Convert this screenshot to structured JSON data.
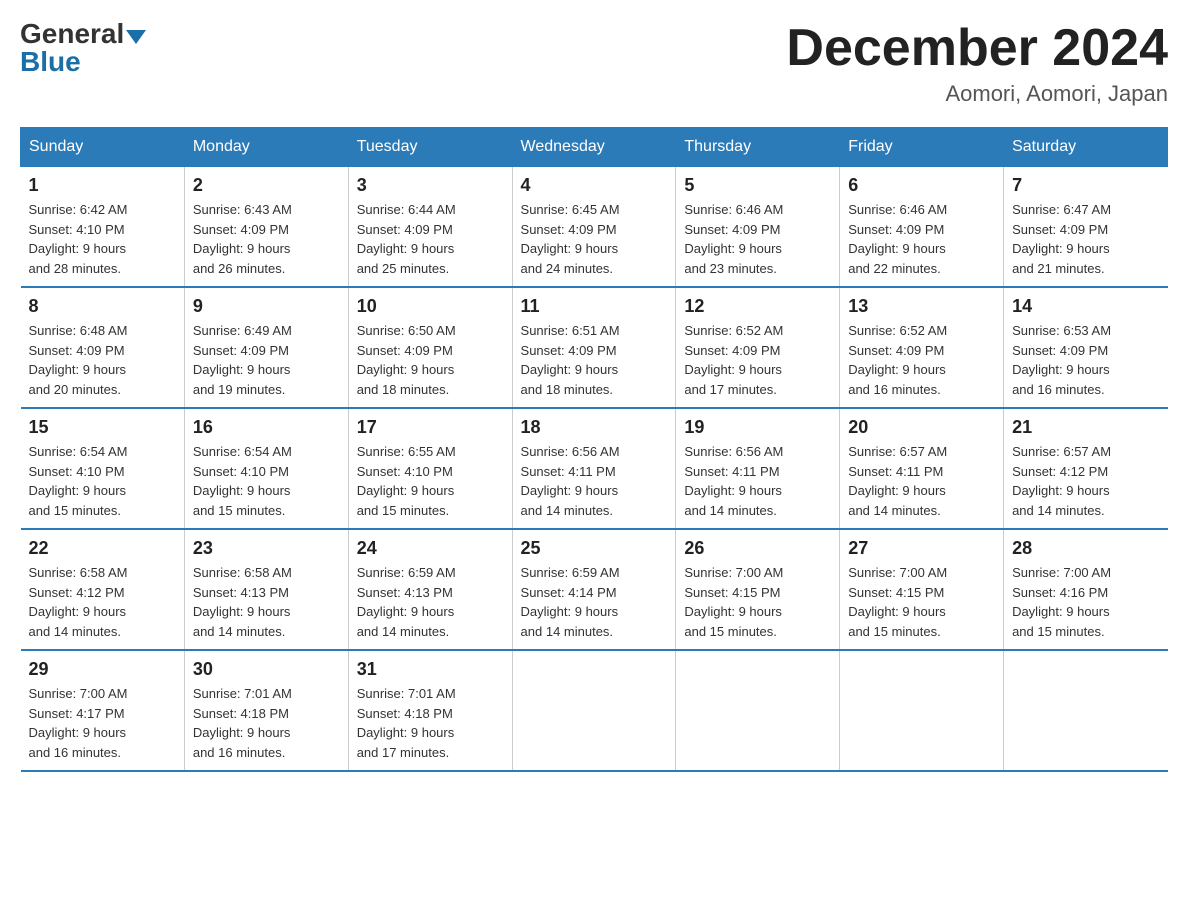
{
  "header": {
    "logo_general": "General",
    "logo_blue": "Blue",
    "month_title": "December 2024",
    "location": "Aomori, Aomori, Japan"
  },
  "weekdays": [
    "Sunday",
    "Monday",
    "Tuesday",
    "Wednesday",
    "Thursday",
    "Friday",
    "Saturday"
  ],
  "weeks": [
    [
      {
        "day": "1",
        "sunrise": "6:42 AM",
        "sunset": "4:10 PM",
        "daylight": "9 hours and 28 minutes."
      },
      {
        "day": "2",
        "sunrise": "6:43 AM",
        "sunset": "4:09 PM",
        "daylight": "9 hours and 26 minutes."
      },
      {
        "day": "3",
        "sunrise": "6:44 AM",
        "sunset": "4:09 PM",
        "daylight": "9 hours and 25 minutes."
      },
      {
        "day": "4",
        "sunrise": "6:45 AM",
        "sunset": "4:09 PM",
        "daylight": "9 hours and 24 minutes."
      },
      {
        "day": "5",
        "sunrise": "6:46 AM",
        "sunset": "4:09 PM",
        "daylight": "9 hours and 23 minutes."
      },
      {
        "day": "6",
        "sunrise": "6:46 AM",
        "sunset": "4:09 PM",
        "daylight": "9 hours and 22 minutes."
      },
      {
        "day": "7",
        "sunrise": "6:47 AM",
        "sunset": "4:09 PM",
        "daylight": "9 hours and 21 minutes."
      }
    ],
    [
      {
        "day": "8",
        "sunrise": "6:48 AM",
        "sunset": "4:09 PM",
        "daylight": "9 hours and 20 minutes."
      },
      {
        "day": "9",
        "sunrise": "6:49 AM",
        "sunset": "4:09 PM",
        "daylight": "9 hours and 19 minutes."
      },
      {
        "day": "10",
        "sunrise": "6:50 AM",
        "sunset": "4:09 PM",
        "daylight": "9 hours and 18 minutes."
      },
      {
        "day": "11",
        "sunrise": "6:51 AM",
        "sunset": "4:09 PM",
        "daylight": "9 hours and 18 minutes."
      },
      {
        "day": "12",
        "sunrise": "6:52 AM",
        "sunset": "4:09 PM",
        "daylight": "9 hours and 17 minutes."
      },
      {
        "day": "13",
        "sunrise": "6:52 AM",
        "sunset": "4:09 PM",
        "daylight": "9 hours and 16 minutes."
      },
      {
        "day": "14",
        "sunrise": "6:53 AM",
        "sunset": "4:09 PM",
        "daylight": "9 hours and 16 minutes."
      }
    ],
    [
      {
        "day": "15",
        "sunrise": "6:54 AM",
        "sunset": "4:10 PM",
        "daylight": "9 hours and 15 minutes."
      },
      {
        "day": "16",
        "sunrise": "6:54 AM",
        "sunset": "4:10 PM",
        "daylight": "9 hours and 15 minutes."
      },
      {
        "day": "17",
        "sunrise": "6:55 AM",
        "sunset": "4:10 PM",
        "daylight": "9 hours and 15 minutes."
      },
      {
        "day": "18",
        "sunrise": "6:56 AM",
        "sunset": "4:11 PM",
        "daylight": "9 hours and 14 minutes."
      },
      {
        "day": "19",
        "sunrise": "6:56 AM",
        "sunset": "4:11 PM",
        "daylight": "9 hours and 14 minutes."
      },
      {
        "day": "20",
        "sunrise": "6:57 AM",
        "sunset": "4:11 PM",
        "daylight": "9 hours and 14 minutes."
      },
      {
        "day": "21",
        "sunrise": "6:57 AM",
        "sunset": "4:12 PM",
        "daylight": "9 hours and 14 minutes."
      }
    ],
    [
      {
        "day": "22",
        "sunrise": "6:58 AM",
        "sunset": "4:12 PM",
        "daylight": "9 hours and 14 minutes."
      },
      {
        "day": "23",
        "sunrise": "6:58 AM",
        "sunset": "4:13 PM",
        "daylight": "9 hours and 14 minutes."
      },
      {
        "day": "24",
        "sunrise": "6:59 AM",
        "sunset": "4:13 PM",
        "daylight": "9 hours and 14 minutes."
      },
      {
        "day": "25",
        "sunrise": "6:59 AM",
        "sunset": "4:14 PM",
        "daylight": "9 hours and 14 minutes."
      },
      {
        "day": "26",
        "sunrise": "7:00 AM",
        "sunset": "4:15 PM",
        "daylight": "9 hours and 15 minutes."
      },
      {
        "day": "27",
        "sunrise": "7:00 AM",
        "sunset": "4:15 PM",
        "daylight": "9 hours and 15 minutes."
      },
      {
        "day": "28",
        "sunrise": "7:00 AM",
        "sunset": "4:16 PM",
        "daylight": "9 hours and 15 minutes."
      }
    ],
    [
      {
        "day": "29",
        "sunrise": "7:00 AM",
        "sunset": "4:17 PM",
        "daylight": "9 hours and 16 minutes."
      },
      {
        "day": "30",
        "sunrise": "7:01 AM",
        "sunset": "4:18 PM",
        "daylight": "9 hours and 16 minutes."
      },
      {
        "day": "31",
        "sunrise": "7:01 AM",
        "sunset": "4:18 PM",
        "daylight": "9 hours and 17 minutes."
      },
      null,
      null,
      null,
      null
    ]
  ],
  "labels": {
    "sunrise": "Sunrise:",
    "sunset": "Sunset:",
    "daylight": "Daylight:"
  }
}
